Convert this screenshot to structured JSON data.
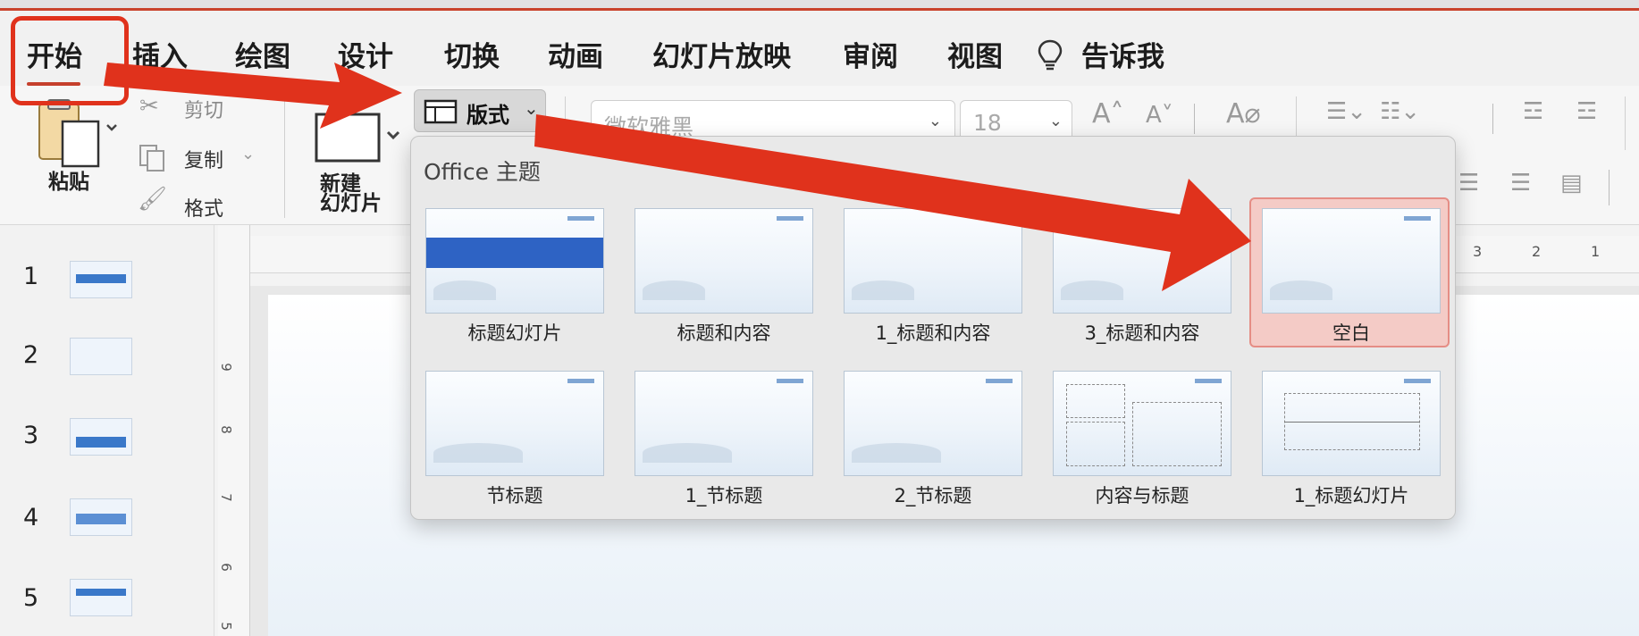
{
  "tabs": [
    "开始",
    "插入",
    "绘图",
    "设计",
    "切换",
    "动画",
    "幻灯片放映",
    "审阅",
    "视图"
  ],
  "tell_me": "告诉我",
  "ribbon": {
    "paste": "粘贴",
    "cut": "剪切",
    "copy": "复制",
    "format_painter": "格式",
    "new_slide_line1": "新建",
    "new_slide_line2": "幻灯片",
    "layout_button": "版式",
    "font_name": "微软雅黑",
    "font_size": "18"
  },
  "ruler": {
    "horizontal": [
      "3",
      "2",
      "1"
    ],
    "vertical": [
      "9",
      "8",
      "7",
      "6",
      "5"
    ]
  },
  "slides": [
    "1",
    "2",
    "3",
    "4",
    "5"
  ],
  "layout_gallery": {
    "header": "Office 主题",
    "items": [
      "标题幻灯片",
      "标题和内容",
      "1_标题和内容",
      "3_标题和内容",
      "空白",
      "节标题",
      "1_节标题",
      "2_节标题",
      "内容与标题",
      "1_标题幻灯片"
    ],
    "selected": "空白"
  },
  "colors": {
    "annotation": "#e0321c",
    "selection": "#f4cbc6",
    "accent": "#c5402d"
  }
}
